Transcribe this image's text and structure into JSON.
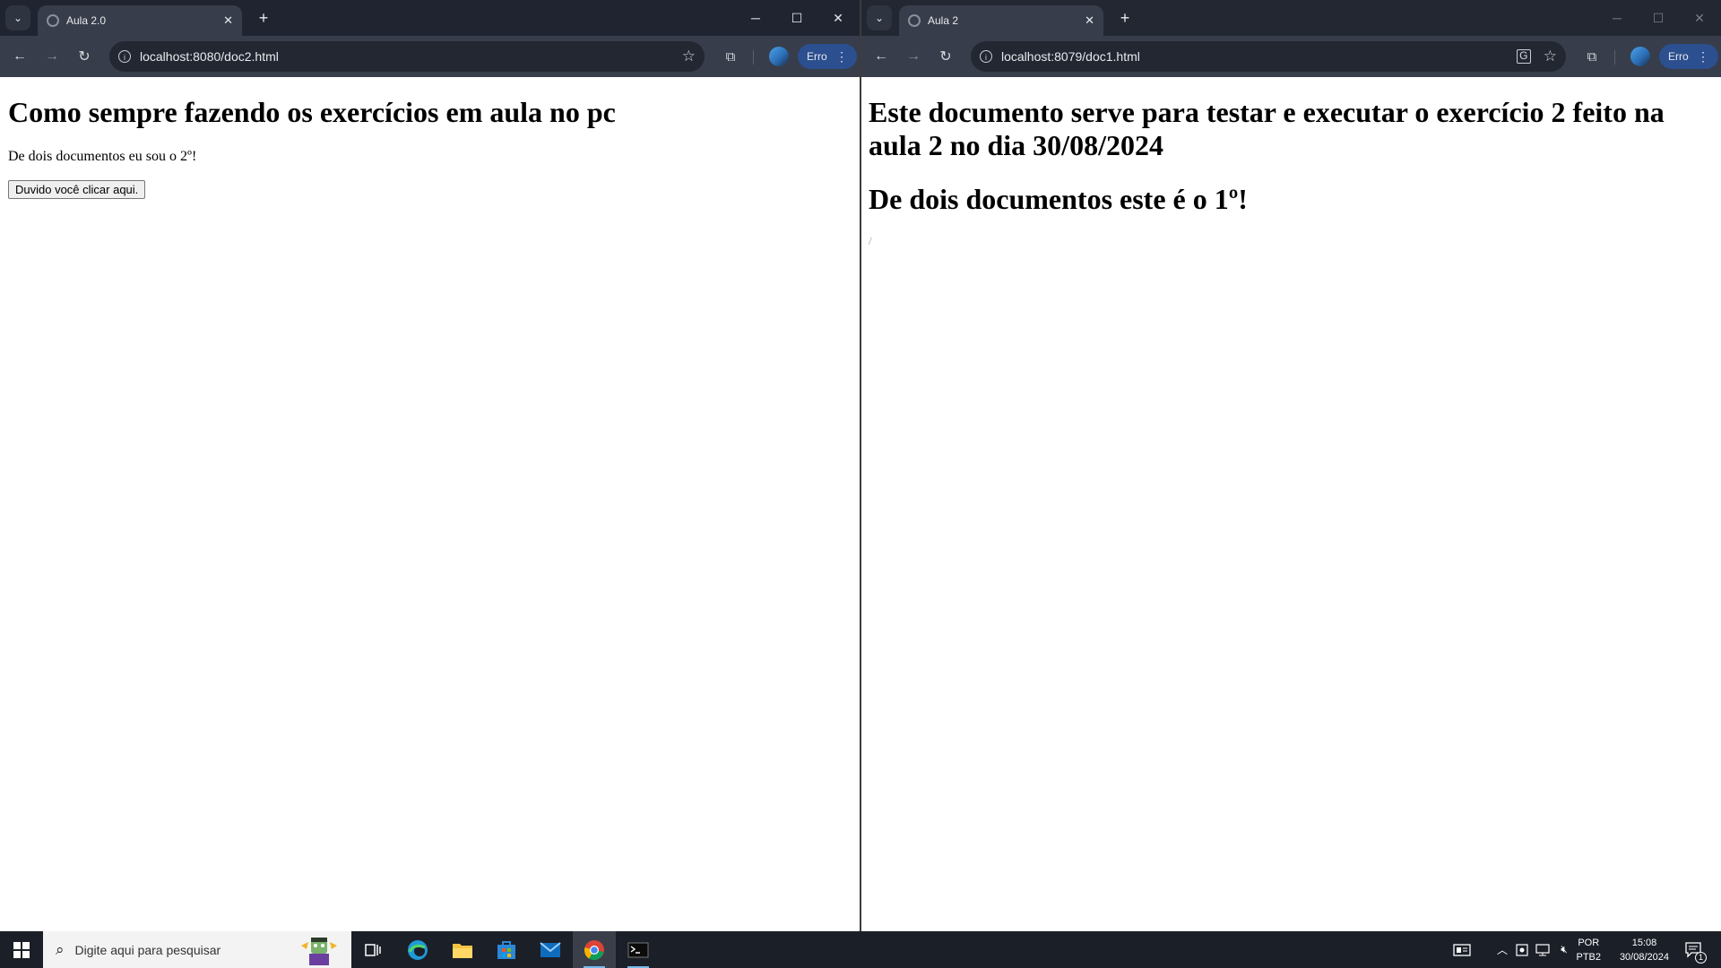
{
  "left_window": {
    "tab_title": "Aula 2.0",
    "url": "localhost:8080/doc2.html",
    "profile_button": "Erro",
    "page": {
      "heading": "Como sempre fazendo os exercícios em aula no pc",
      "paragraph": "De dois documentos eu sou o 2º!",
      "button_label": "Duvido você clicar aqui."
    }
  },
  "right_window": {
    "tab_title": "Aula 2",
    "url": "localhost:8079/doc1.html",
    "profile_button": "Erro",
    "page": {
      "heading1": "Este documento serve para testar e executar o exercício 2 feito na aula 2 no dia 30/08/2024",
      "heading2": "De dois documentos este é o 1º!",
      "stray_text": "/"
    }
  },
  "taskbar": {
    "search_placeholder": "Digite aqui para pesquisar",
    "language_top": "POR",
    "language_bottom": "PTB2",
    "time": "15:08",
    "date": "30/08/2024",
    "notification_count": "1"
  },
  "colors": {
    "accent": "#4f8df6",
    "titlebar": "#1f2430",
    "toolbar": "#373d4a",
    "taskbar": "#1b1f28"
  }
}
